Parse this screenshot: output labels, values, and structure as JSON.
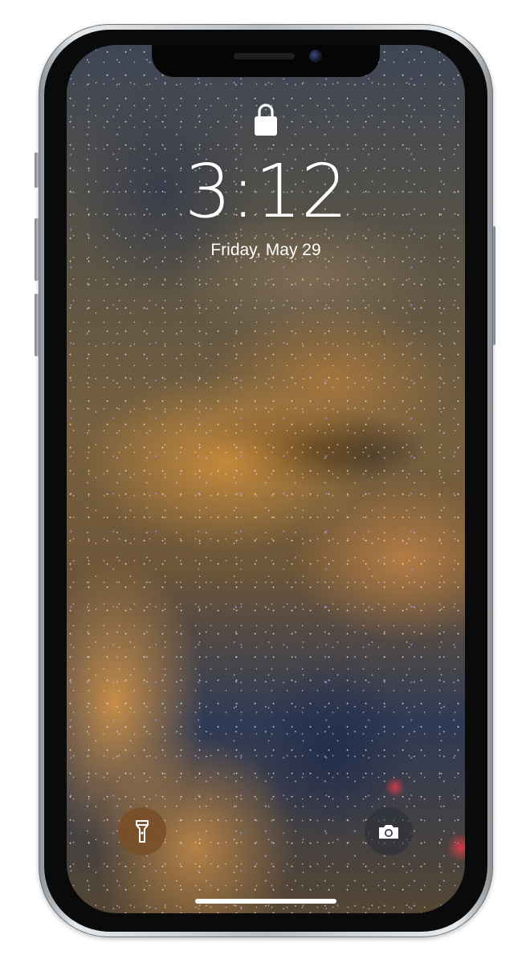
{
  "lock_screen": {
    "time": "3:12",
    "date": "Friday, May 29",
    "status": "locked"
  },
  "icons": {
    "lock": "padlock-icon",
    "flashlight": "flashlight-icon",
    "camera": "camera-icon"
  },
  "colors": {
    "text": "#ffffff",
    "flashlight_button_bg": "#784e26",
    "camera_button_bg": "#282d37",
    "home_indicator": "#ffffff"
  }
}
